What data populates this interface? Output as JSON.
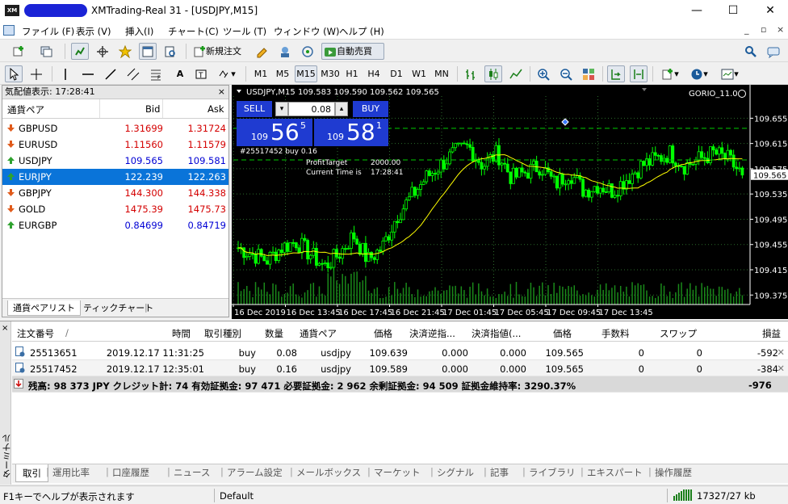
{
  "window": {
    "title": "XMTrading-Real 31 - [USDJPY,M15]",
    "logo_text": "XM",
    "minimize": "—",
    "maximize": "☐",
    "close": "✕"
  },
  "menu": {
    "items": [
      "ファイル (F)",
      "表示 (V)",
      "挿入(I)",
      "チャート(C)",
      "ツール (T)",
      "ウィンドウ (W)",
      "ヘルプ (H)"
    ],
    "right_controls": [
      "_",
      "▫",
      "×"
    ]
  },
  "toolbar1": {
    "new_order": "新規注文",
    "auto_trade": "自動売買"
  },
  "toolbar2": {
    "timeframes": [
      "M1",
      "M5",
      "M15",
      "M30",
      "H1",
      "H4",
      "D1",
      "W1",
      "MN"
    ],
    "active_timeframe": "M15",
    "text_tool": "A",
    "zoom_plus": "+",
    "zoom_minus": "−"
  },
  "market_watch": {
    "header": "気配値表示: 17:28:41",
    "close": "×",
    "col_symbol": "通貨ペア",
    "col_bid": "Bid",
    "col_ask": "Ask",
    "rows": [
      {
        "symbol": "GBPUSD",
        "bid": "1.31699",
        "ask": "1.31724",
        "dir": "down",
        "color": "#d40000"
      },
      {
        "symbol": "EURUSD",
        "bid": "1.11560",
        "ask": "1.11579",
        "dir": "down",
        "color": "#d40000"
      },
      {
        "symbol": "USDJPY",
        "bid": "109.565",
        "ask": "109.581",
        "dir": "up",
        "color": "#0000d4"
      },
      {
        "symbol": "EURJPY",
        "bid": "122.239",
        "ask": "122.263",
        "dir": "up",
        "color": "#0000d4"
      },
      {
        "symbol": "GBPJPY",
        "bid": "144.300",
        "ask": "144.338",
        "dir": "down",
        "color": "#d40000"
      },
      {
        "symbol": "GOLD",
        "bid": "1475.39",
        "ask": "1475.73",
        "dir": "down",
        "color": "#d40000"
      },
      {
        "symbol": "EURGBP",
        "bid": "0.84699",
        "ask": "0.84719",
        "dir": "up",
        "color": "#0000d4"
      }
    ],
    "selected_index": 3,
    "tabs": [
      "通貨ペアリスト",
      "ティックチャート"
    ]
  },
  "chart": {
    "info": "USDJPY,M15  109.583 109.590 109.562 109.565",
    "indicator_name": "GORIO_11.0",
    "sell_label": "SELL",
    "buy_label": "BUY",
    "lot": "0.08",
    "sell_prefix": "109",
    "sell_big": "56",
    "sell_sup": "5",
    "buy_prefix": "109",
    "buy_big": "58",
    "buy_sup": "1",
    "order_label": "#25517452 buy 0.16",
    "profit_target_label": "ProfitTarget",
    "profit_target_value": "2000.00",
    "current_time_label": "Current Time is",
    "current_time_value": "17:28:41",
    "current_price": "109.565",
    "price_ticks": [
      "109.655",
      "109.615",
      "109.575",
      "109.535",
      "109.495",
      "109.455",
      "109.415",
      "109.375"
    ],
    "time_ticks": [
      "16 Dec 2019",
      "16 Dec 13:45",
      "16 Dec 17:45",
      "16 Dec 21:45",
      "17 Dec 01:45",
      "17 Dec 05:45",
      "17 Dec 09:45",
      "17 Dec 13:45"
    ],
    "colors": {
      "bull": "#00ff00",
      "bear": "#00ff00",
      "ma": "#ffff00",
      "grid": "#2b6b2b",
      "bg": "#000000"
    }
  },
  "chart_data": {
    "type": "candlestick",
    "title": "USDJPY,M15",
    "ylim": [
      109.36,
      109.69
    ],
    "x_range": [
      "16 Dec 2019",
      "17 Dec 17:30"
    ],
    "close_series_approx": [
      109.45,
      109.44,
      109.43,
      109.45,
      109.46,
      109.44,
      109.42,
      109.44,
      109.47,
      109.43,
      109.45,
      109.5,
      109.53,
      109.56,
      109.58,
      109.6,
      109.61,
      109.58,
      109.6,
      109.56,
      109.57,
      109.58,
      109.55,
      109.57,
      109.54,
      109.55,
      109.54,
      109.56,
      109.58,
      109.59,
      109.6,
      109.58,
      109.59,
      109.6,
      109.59,
      109.565
    ],
    "moving_average_end": 109.575,
    "horizontal_levels": [
      109.639,
      109.589
    ]
  },
  "terminal": {
    "side_label": "ターミナル",
    "close": "×",
    "columns": [
      "注文番号",
      "/",
      "時間",
      "取引種別",
      "数量",
      "通貨ペア",
      "価格",
      "決済逆指...",
      "決済指値(...",
      "価格",
      "手数料",
      "スワップ",
      "損益"
    ],
    "orders": [
      {
        "ticket": "25513651",
        "time": "2019.12.17 11:31:25",
        "type": "buy",
        "size": "0.08",
        "symbol": "usdjpy",
        "price": "109.639",
        "sl": "0.000",
        "tp": "0.000",
        "cur": "109.565",
        "commission": "0",
        "swap": "0",
        "profit": "-592"
      },
      {
        "ticket": "25517452",
        "time": "2019.12.17 12:35:01",
        "type": "buy",
        "size": "0.16",
        "symbol": "usdjpy",
        "price": "109.589",
        "sl": "0.000",
        "tp": "0.000",
        "cur": "109.565",
        "commission": "0",
        "swap": "0",
        "profit": "-384"
      }
    ],
    "summary": "残高: 98 373 JPY  クレジット計: 74  有効証拠金: 97 471  必要証拠金: 2 962  余剰証拠金: 94 509  証拠金維持率: 3290.37%",
    "summary_total": "-976",
    "tabs": [
      "取引",
      "運用比率",
      "口座履歴",
      "ニュース",
      "アラーム設定",
      "メールボックス",
      "マーケット",
      "シグナル",
      "記事",
      "ライブラリ",
      "エキスパート",
      "操作履歴"
    ]
  },
  "status": {
    "help": "F1キーでヘルプが表示されます",
    "profile": "Default",
    "traffic": "17327/27 kb"
  }
}
